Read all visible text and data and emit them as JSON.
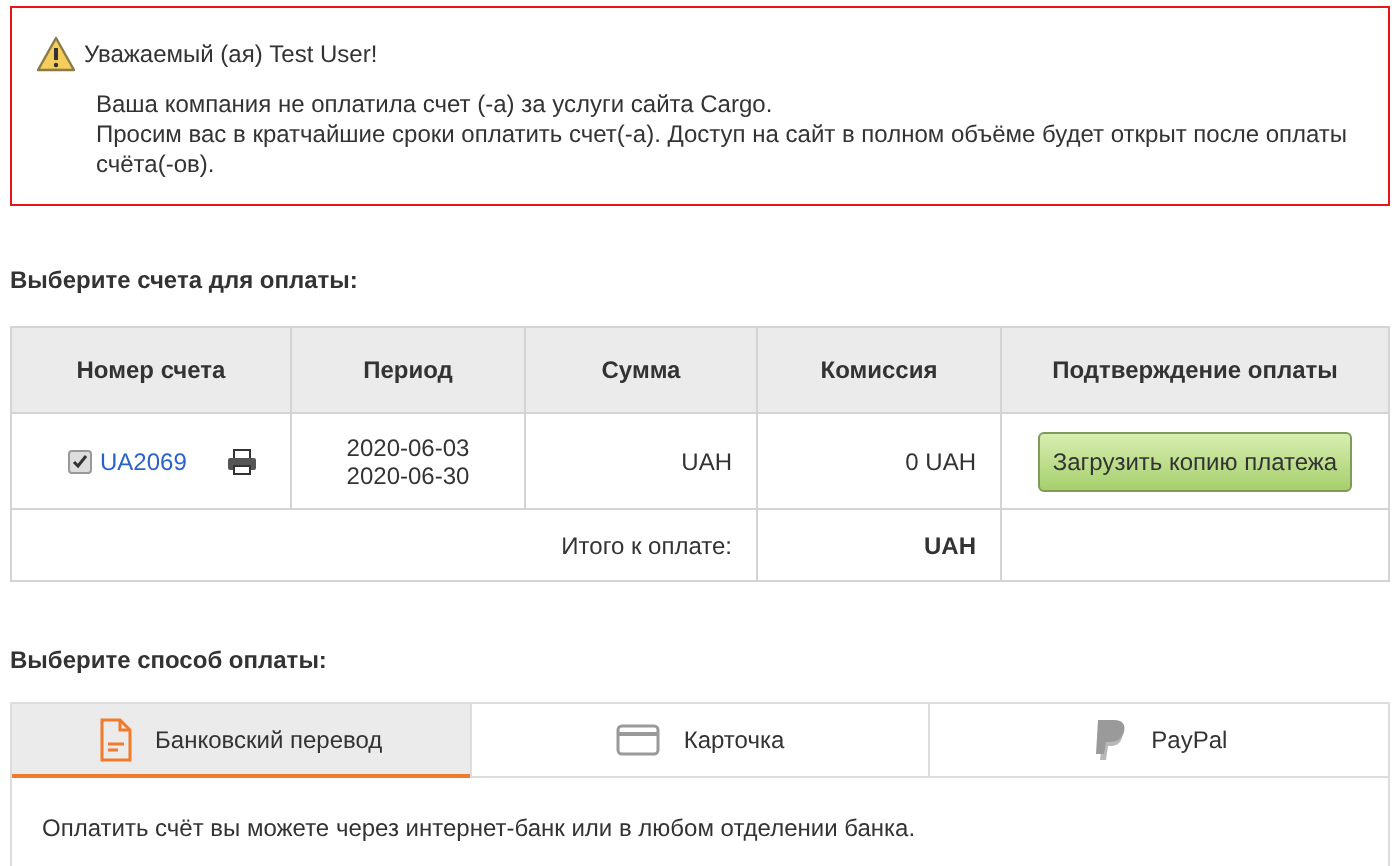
{
  "alert": {
    "greeting": "Уважаемый (ая) Test User!",
    "message": "Ваша компания не оплатила счет (-а) за услуги сайта Cargo.\nПросим вас в кратчайшие сроки оплатить счет(-а). Доступ на сайт в полном объёме будет открыт после оплаты счёта(-ов)."
  },
  "invoices_heading": "Выберите счета для оплаты:",
  "table": {
    "columns": [
      "Номер счета",
      "Период",
      "Сумма",
      "Комиссия",
      "Подтверждение оплаты"
    ],
    "rows": [
      {
        "checked": true,
        "number": "UA2069",
        "period_start": "2020-06-03",
        "period_end": "2020-06-30",
        "amount": "UAH",
        "commission": "0 UAH",
        "button": "Загрузить копию платежа"
      }
    ],
    "total_label": "Итого к оплате:",
    "total": "UAH"
  },
  "method_heading": "Выберите способ оплаты:",
  "tabs": [
    {
      "kind": "bank",
      "label": "Банковский перевод",
      "selected": true
    },
    {
      "kind": "card",
      "label": "Карточка",
      "selected": false
    },
    {
      "kind": "paypal",
      "label": "PayPal",
      "selected": false
    }
  ],
  "tab_content": "Оплатить счёт вы можете через интернет-банк или в любом отделении банка."
}
